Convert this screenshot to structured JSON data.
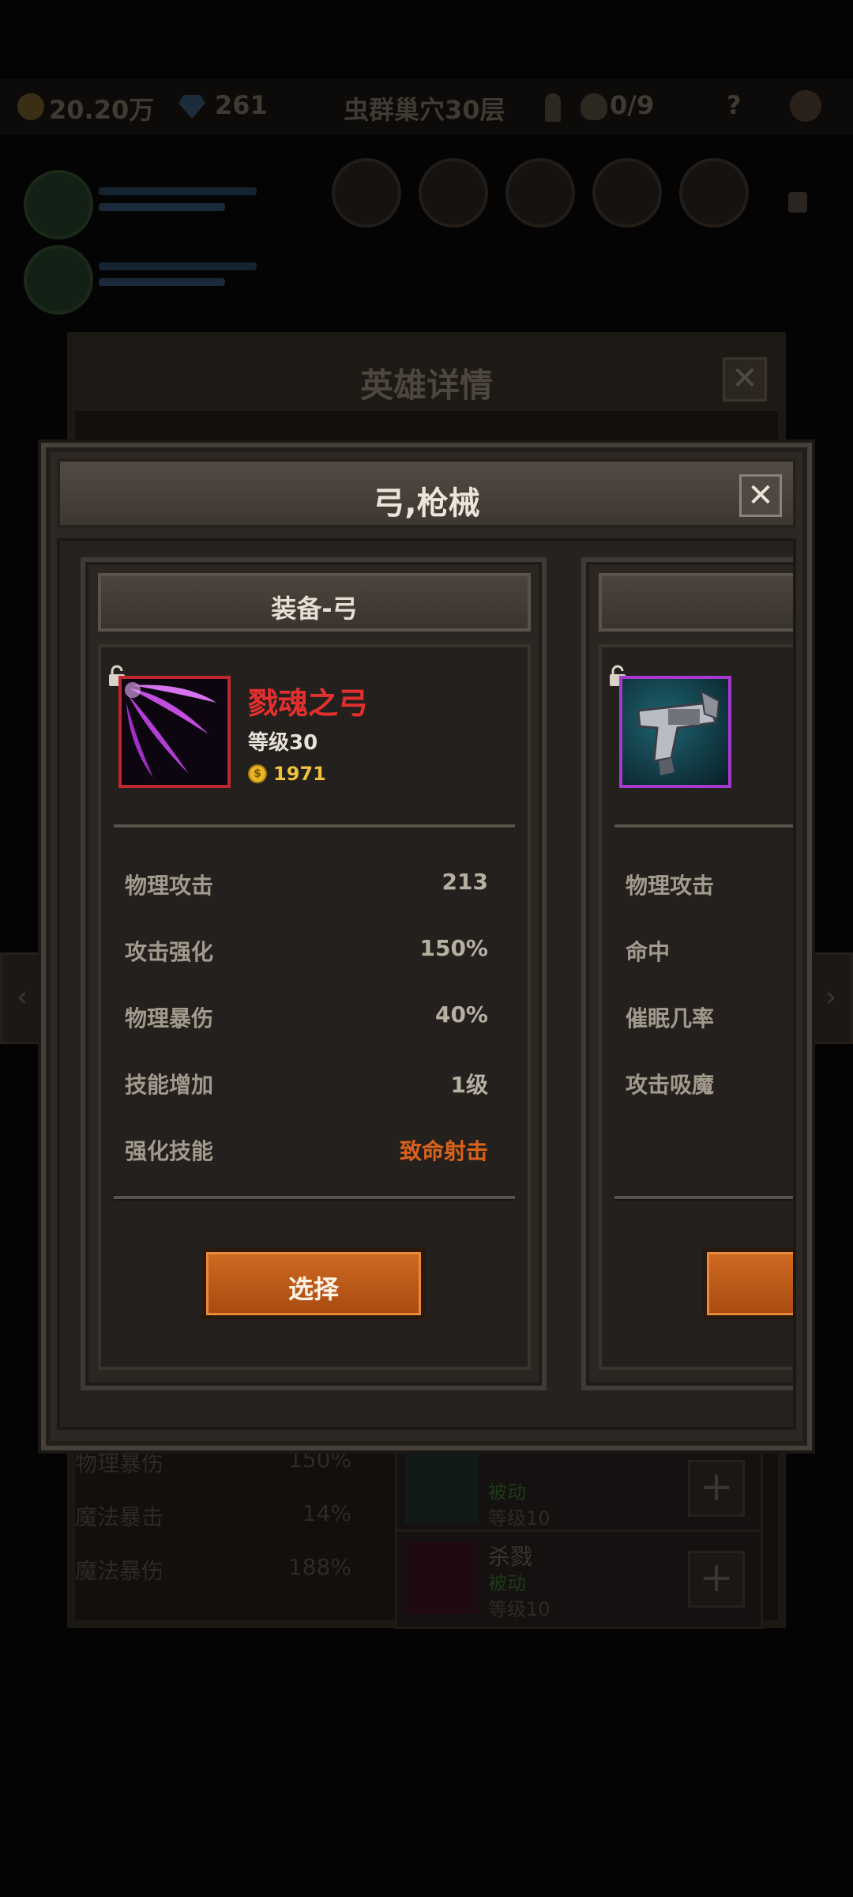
{
  "background": {
    "topbar": {
      "gold": "20.20万",
      "gems": "261",
      "location": "虫群巢穴30层",
      "key_skull_count": "0/9",
      "help": "?"
    },
    "hero_detail_title": "英雄详情",
    "close_glyph": "✕",
    "stats": [
      {
        "label": "物理暴伤",
        "value": "150%"
      },
      {
        "label": "魔法暴击",
        "value": "14%"
      },
      {
        "label": "魔法暴伤",
        "value": "188%"
      }
    ],
    "skills": [
      {
        "name": "",
        "type": "被动",
        "level": "等级10"
      },
      {
        "name": "杀戮",
        "type": "被动",
        "level": "等级10"
      }
    ],
    "plus_glyph": "+"
  },
  "dialog": {
    "title": "弓,枪械",
    "close_glyph": "✕",
    "cards": [
      {
        "category": "装备-弓",
        "item_name": "戮魂之弓",
        "level": "等级30",
        "price": "1971",
        "coin_symbol": "$",
        "rarity_color": "#c0262e",
        "stats": [
          {
            "label": "物理攻击",
            "value": "213"
          },
          {
            "label": "攻击强化",
            "value": "150%"
          },
          {
            "label": "物理暴伤",
            "value": "40%"
          },
          {
            "label": "技能增加",
            "value": "1级"
          },
          {
            "label": "强化技能",
            "value": "致命射击"
          }
        ],
        "button": "选择"
      },
      {
        "rarity_color": "#a43ad0",
        "stats": [
          {
            "label": "物理攻击"
          },
          {
            "label": "命中"
          },
          {
            "label": "催眠几率"
          },
          {
            "label": "攻击吸魔"
          }
        ]
      }
    ]
  }
}
